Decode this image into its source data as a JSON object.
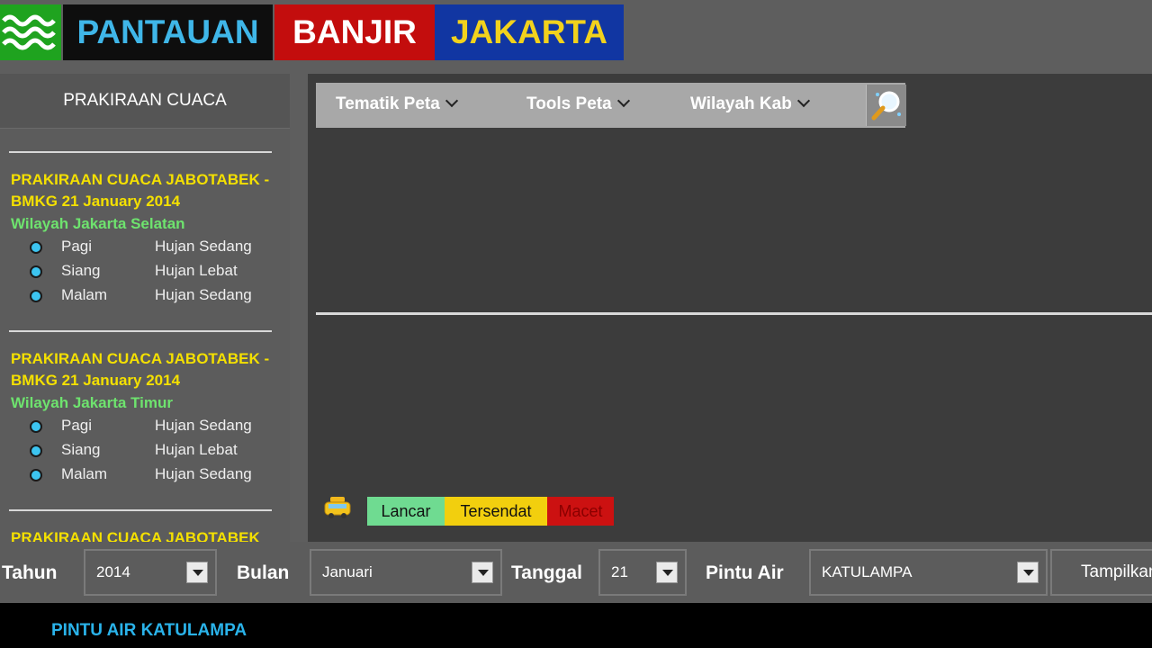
{
  "header": {
    "logo_icon": "waves-icon",
    "title_part1": "PANTAUAN",
    "title_part2": "BANJIR",
    "title_part3": "JAKARTA"
  },
  "sidebar": {
    "title": "PRAKIRAAN CUACA",
    "forecasts": [
      {
        "title": "PRAKIRAAN CUACA JABOTABEK - BMKG 21 January 2014",
        "region": "Wilayah Jakarta Selatan",
        "rows": [
          {
            "time": "Pagi",
            "value": "Hujan Sedang"
          },
          {
            "time": "Siang",
            "value": "Hujan Lebat"
          },
          {
            "time": "Malam",
            "value": "Hujan Sedang"
          }
        ]
      },
      {
        "title": "PRAKIRAAN CUACA JABOTABEK - BMKG 21 January 2014",
        "region": "Wilayah Jakarta Timur",
        "rows": [
          {
            "time": "Pagi",
            "value": "Hujan Sedang"
          },
          {
            "time": "Siang",
            "value": "Hujan Lebat"
          },
          {
            "time": "Malam",
            "value": "Hujan Sedang"
          }
        ]
      }
    ],
    "partial_title": "PRAKIRAAN CUACA JABOTABEK"
  },
  "map": {
    "toolbar": {
      "tematik": "Tematik Peta",
      "tools": "Tools Peta",
      "wilayah": "Wilayah Kab"
    },
    "traffic_icon": "car-icon",
    "legend": {
      "lancar": "Lancar",
      "tersendat": "Tersendat",
      "macet": "Macet"
    }
  },
  "filters": {
    "tahun_label": "Tahun",
    "tahun_value": "2014",
    "bulan_label": "Bulan",
    "bulan_value": "Januari",
    "tanggal_label": "Tanggal",
    "tanggal_value": "21",
    "pintu_label": "Pintu Air",
    "pintu_value": "KATULAMPA",
    "show_button": "Tampilkan"
  },
  "bottom": {
    "title": "PINTU AIR KATULAMPA"
  },
  "colors": {
    "logo_green": "#1fa31f",
    "title_blue": "#3fb6e8",
    "title_red_bg": "#c30d0d",
    "title_navy_bg": "#1136a2",
    "title_yellow": "#f2d21c",
    "forecast_yellow": "#f4e000",
    "region_green": "#6ee36e",
    "lancar": "#6fdb91",
    "tersendat": "#f2cf0e",
    "macet": "#cc1111"
  }
}
